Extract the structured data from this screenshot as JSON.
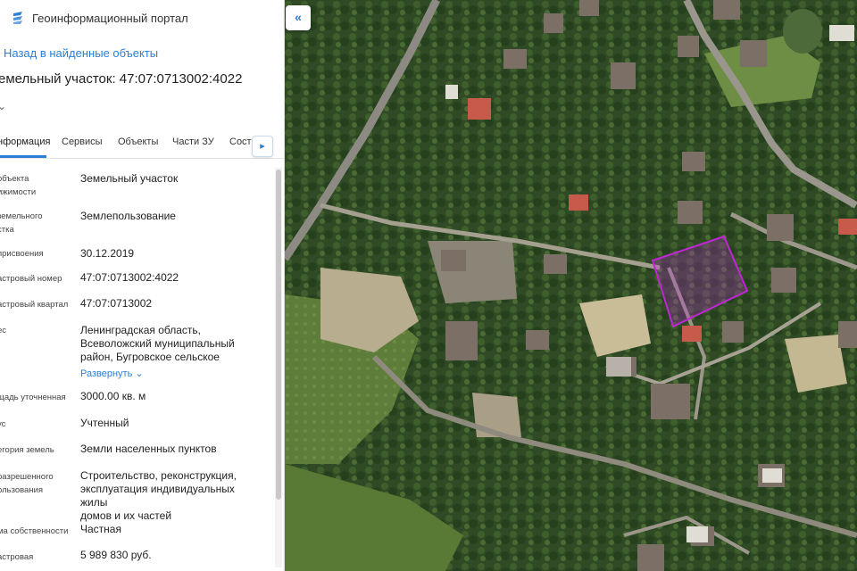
{
  "header": {
    "portal_title": "Геоинформационный портал",
    "logo_icon": "stacked-layers-icon"
  },
  "nav": {
    "back_label": "Назад в найденные объекты",
    "collapse_icon": "double-chevron-left-icon"
  },
  "object": {
    "title": "емельный участок: 47:07:0713002:4022"
  },
  "tabs": [
    {
      "label": "нформация",
      "active": true
    },
    {
      "label": "Сервисы"
    },
    {
      "label": "Объекты"
    },
    {
      "label": "Части ЗУ"
    },
    {
      "label": "Соста"
    }
  ],
  "details": [
    {
      "label": "объекта\nижимости",
      "value": "Земельный участок"
    },
    {
      "label": "земельного\nстка",
      "value": "Землепользование"
    },
    {
      "label": "присвоения",
      "value": "30.12.2019"
    },
    {
      "label": "астровый номер",
      "value": "47:07:0713002:4022"
    },
    {
      "label": "астровый квартал",
      "value": "47:07:0713002"
    },
    {
      "label": "ес",
      "value": "Ленинградская область,\nВсеволожский муниципальный\nрайон, Бугровское сельское"
    },
    {
      "label": "щадь уточненная",
      "value": "3000.00 кв. м"
    },
    {
      "label": "ус",
      "value": "Учтенный"
    },
    {
      "label": "егория земель",
      "value": "Земли населенных пунктов"
    },
    {
      "label": "разрешенного\nользования",
      "value": "Строительство, реконструкция,\nэксплуатация индивидуальных жилы\nдомов и их частей"
    },
    {
      "label": "ма собственности",
      "value": "Частная"
    },
    {
      "label": "астровая",
      "value": "5 989 830 руб."
    }
  ],
  "expand_label": "Развернуть",
  "colors": {
    "accent": "#2b7fd6",
    "parcel_outline": "#c026d3"
  }
}
